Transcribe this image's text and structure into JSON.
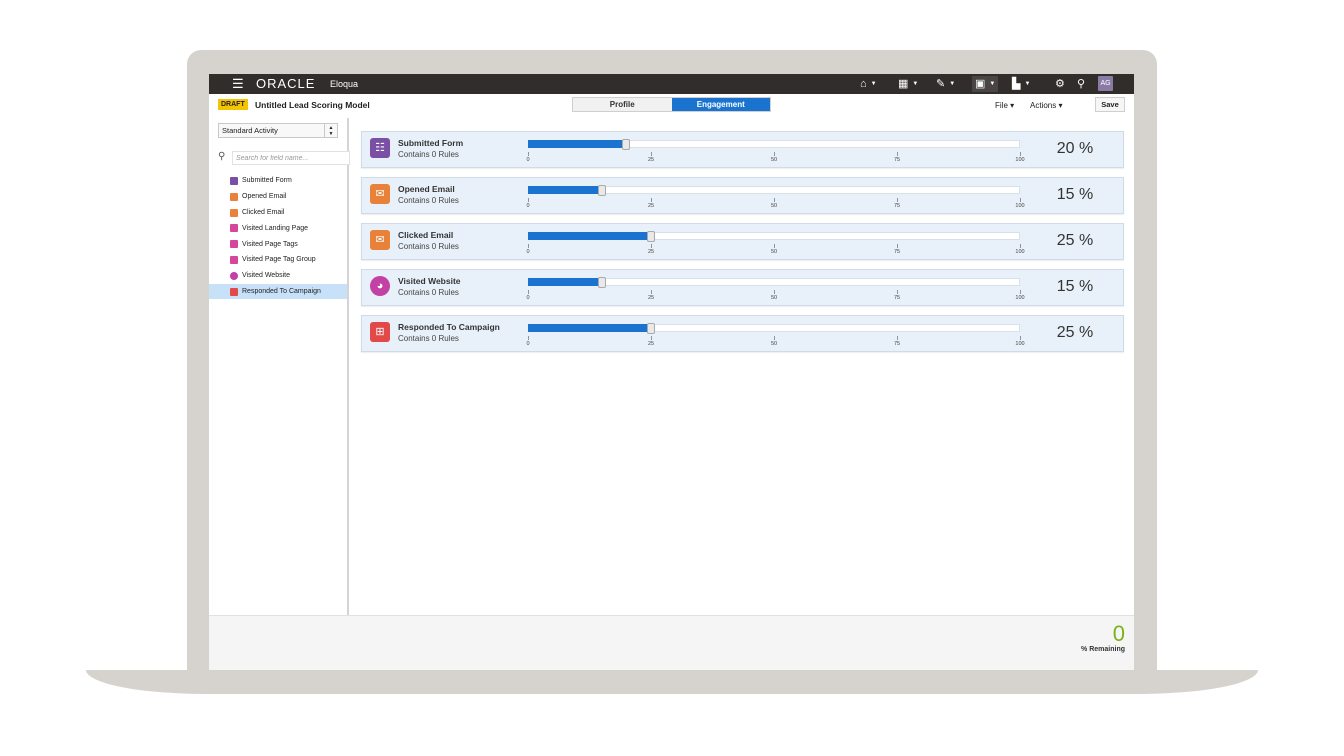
{
  "topbar": {
    "brand": "ORACLE",
    "product": "Eloqua",
    "avatar_initials": "AG"
  },
  "header": {
    "status_badge": "DRAFT",
    "title": "Untitled Lead Scoring Model",
    "tabs": [
      {
        "label": "Profile",
        "active": false
      },
      {
        "label": "Engagement",
        "active": true
      }
    ],
    "file_menu": "File",
    "actions_menu": "Actions",
    "save_label": "Save"
  },
  "sidebar": {
    "activity_type": "Standard Activity",
    "search_placeholder": "Search for field name...",
    "items": [
      {
        "label": "Submitted Form",
        "color": "#7b4fa3"
      },
      {
        "label": "Opened Email",
        "color": "#e8823a"
      },
      {
        "label": "Clicked Email",
        "color": "#e8823a"
      },
      {
        "label": "Visited Landing Page",
        "color": "#d6479c"
      },
      {
        "label": "Visited Page Tags",
        "color": "#d6479c"
      },
      {
        "label": "Visited Page Tag Group",
        "color": "#d6479c"
      },
      {
        "label": "Visited Website",
        "color": "#c340a4"
      },
      {
        "label": "Responded To Campaign",
        "color": "#e24a4a"
      }
    ]
  },
  "criteria": [
    {
      "title": "Submitted Form",
      "rules": "Contains 0 Rules",
      "value": 20,
      "pct_label": "20 %",
      "icon": "form-icon",
      "color": "#7b4fa3"
    },
    {
      "title": "Opened Email",
      "rules": "Contains 0 Rules",
      "value": 15,
      "pct_label": "15 %",
      "icon": "envelope-icon",
      "color": "#e8823a"
    },
    {
      "title": "Clicked Email",
      "rules": "Contains 0 Rules",
      "value": 25,
      "pct_label": "25 %",
      "icon": "email-click-icon",
      "color": "#e8823a"
    },
    {
      "title": "Visited Website",
      "rules": "Contains 0 Rules",
      "value": 15,
      "pct_label": "15 %",
      "icon": "globe-icon",
      "color": "#c340a4"
    },
    {
      "title": "Responded To Campaign",
      "rules": "Contains 0 Rules",
      "value": 25,
      "pct_label": "25 %",
      "icon": "campaign-icon",
      "color": "#e24a4a"
    }
  ],
  "scale_ticks": [
    "0",
    "25",
    "50",
    "75",
    "100"
  ],
  "footer": {
    "remaining_value": "0",
    "remaining_label": "% Remaining"
  }
}
